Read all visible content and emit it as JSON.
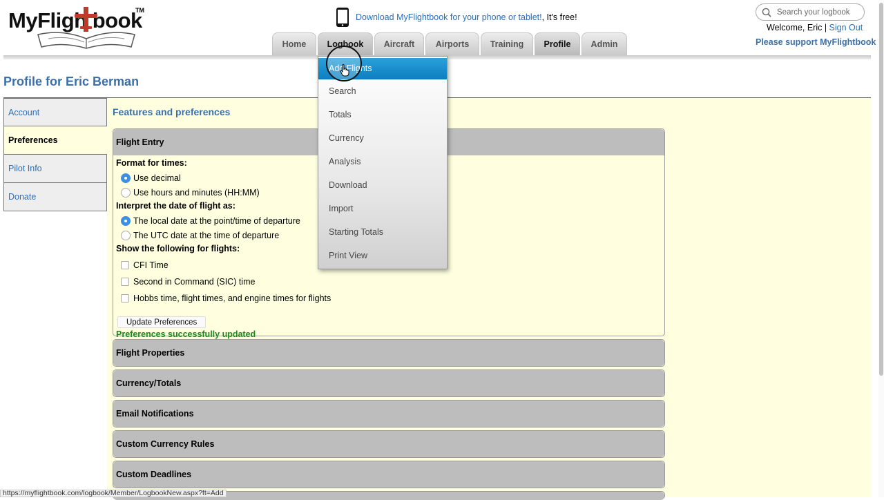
{
  "header": {
    "logo_text": "MyFligh  book",
    "logo_tm": "TM",
    "promo_link": "Download MyFlightbook for your phone or tablet!",
    "promo_suffix": ", It's free!",
    "search_placeholder": "Search your logbook",
    "welcome_text": "Welcome, Eric | ",
    "sign_out": "Sign Out",
    "support_link": "Please support MyFlightbook"
  },
  "tabs": [
    {
      "label": "Home"
    },
    {
      "label": "Logbook"
    },
    {
      "label": "Aircraft"
    },
    {
      "label": "Airports"
    },
    {
      "label": "Training"
    },
    {
      "label": "Profile"
    },
    {
      "label": "Admin"
    }
  ],
  "page_title": "Profile for Eric Berman",
  "side_nav": [
    {
      "label": "Account"
    },
    {
      "label": "Preferences"
    },
    {
      "label": "Pilot Info"
    },
    {
      "label": "Donate"
    }
  ],
  "content": {
    "heading": "Features and preferences",
    "flight_entry": {
      "header": "Flight Entry",
      "format_label": "Format for times:",
      "format_options": [
        "Use decimal",
        "Use hours and minutes (HH:MM)"
      ],
      "date_label": "Interpret the date of flight as:",
      "date_options": [
        "The local date at the point/time of departure",
        "The UTC date at the time of departure"
      ],
      "show_label": "Show the following for flights:",
      "show_options": [
        "CFI Time",
        "Second in Command (SIC) time",
        "Hobbs time, flight times, and engine times for flights"
      ],
      "update_button": "Update Preferences",
      "success_message": "Preferences successfully updated"
    },
    "collapsed_panels": [
      "Flight Properties",
      "Currency/Totals",
      "Email Notifications",
      "Custom Currency Rules",
      "Custom Deadlines"
    ]
  },
  "logbook_menu": [
    "Add Flights",
    "Search",
    "Totals",
    "Currency",
    "Analysis",
    "Download",
    "Import",
    "Starting Totals",
    "Print View"
  ],
  "status_url": "https://myflightbook.com/logbook/Member/LogbookNew.aspx?ft=Add",
  "colors": {
    "link_blue": "#2a6fb5",
    "heading_blue": "#3b6fa8",
    "content_bg": "#ffffe0",
    "success_green": "#1a8a1a",
    "menu_highlight": "#1591d0"
  }
}
